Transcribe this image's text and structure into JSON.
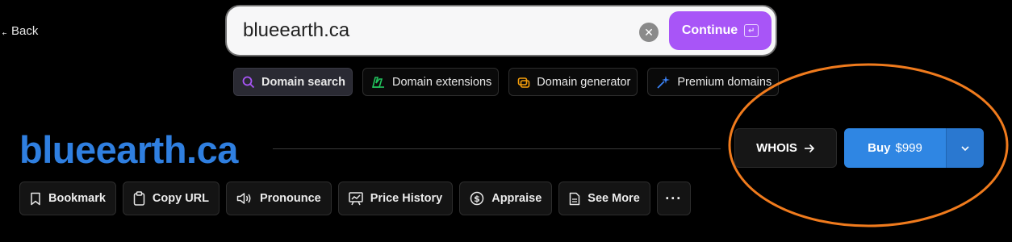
{
  "nav": {
    "back_label": "Back"
  },
  "search": {
    "value": "blueearth.ca",
    "continue_label": "Continue"
  },
  "tools": [
    {
      "label": "Domain search",
      "icon": "search-icon",
      "color": "#a855f7"
    },
    {
      "label": "Domain extensions",
      "icon": "extensions-icon",
      "color": "#22c55e"
    },
    {
      "label": "Domain generator",
      "icon": "generator-icon",
      "color": "#f59e0b"
    },
    {
      "label": "Premium domains",
      "icon": "sparkle-icon",
      "color": "#3b82f6"
    }
  ],
  "domain": {
    "name": "blueearth.ca",
    "color": "#2f7fe0"
  },
  "whois_label": "WHOIS",
  "buy": {
    "label": "Buy",
    "price": "$999",
    "color": "#2f86e3"
  },
  "actions": [
    {
      "label": "Bookmark",
      "icon": "bookmark-icon"
    },
    {
      "label": "Copy URL",
      "icon": "clipboard-icon"
    },
    {
      "label": "Pronounce",
      "icon": "speaker-icon"
    },
    {
      "label": "Price History",
      "icon": "chart-icon"
    },
    {
      "label": "Appraise",
      "icon": "dollar-icon"
    },
    {
      "label": "See More",
      "icon": "document-icon"
    }
  ],
  "annotation_color": "#f07b1d"
}
